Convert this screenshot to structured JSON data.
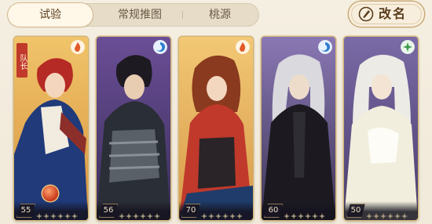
{
  "tabs": [
    {
      "label": "试验",
      "active": true
    },
    {
      "label": "常规推图",
      "active": false
    },
    {
      "label": "桃源",
      "active": false
    }
  ],
  "rename_button": {
    "label": "改名",
    "icon": "compass-pen-icon"
  },
  "team": [
    {
      "level": "55",
      "element": "fire",
      "element_color": "#e05a2a",
      "captain_label": "队长",
      "bg": "#e9b55f",
      "stars": 6
    },
    {
      "level": "56",
      "element": "water",
      "element_color": "#2f7fd1",
      "bg": "#8a5fa8",
      "stars": 6
    },
    {
      "level": "70",
      "element": "fire",
      "element_color": "#e05a2a",
      "bg": "#e8b45a",
      "stars": 6
    },
    {
      "level": "60",
      "element": "water",
      "element_color": "#2f7fd1",
      "bg": "#7b6aa0",
      "stars": 6
    },
    {
      "level": "50",
      "element": "wood",
      "element_color": "#3d9a4e",
      "bg": "#6a5a94",
      "stars": 6
    }
  ]
}
